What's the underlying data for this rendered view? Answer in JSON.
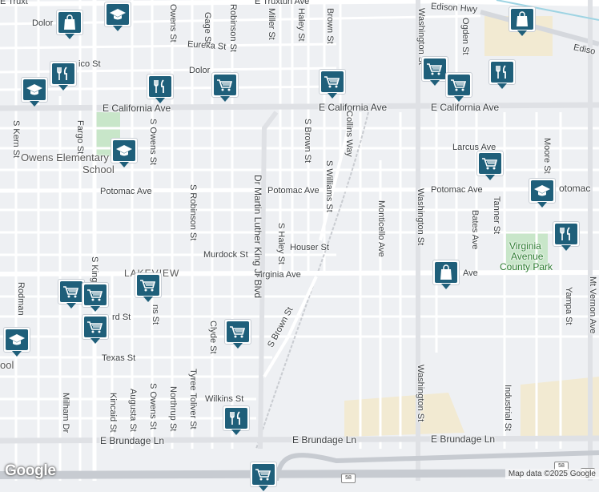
{
  "streets": {
    "e_truxtun": "E Truxtun Ave",
    "e_truxtun_left": "E Truxt",
    "edison_hwy": "Edison Hwy",
    "edison_hwy_right": "Ediso",
    "dolores": "Dolor",
    "dolores2": "Dolor",
    "eureka": "Eureka St",
    "mexico": "ico St",
    "e_california_1": "E California Ave",
    "e_california_2": "E California Ave",
    "larcus": "Larcus Ave",
    "potomac_1": "Potomac Ave",
    "potomac_2": "Potomac Ave",
    "potomac_3": "Potomac Ave",
    "potomac_4": "otomac",
    "murdock": "Murdock St",
    "houser": "Houser St",
    "virginia_1": "Virginia Ave",
    "virginia_2": "Ave",
    "ord": "rd St",
    "texas": "Texas St",
    "wilkins": "Wilkins St",
    "brundage_1": "E Brundage Ln",
    "brundage_2": "E Brundage Ln",
    "brundage_3": "E Brundage Ln",
    "s_kern": "S Kern St",
    "fargo": "Fargo St",
    "s_king": "S King",
    "rodman": "Rodman",
    "milham": "Milham Dr",
    "kincaid": "Kincaid St",
    "augusta": "Augusta St",
    "s_owens_top": "Owens St",
    "s_owens_mid": "S Owens St",
    "s_owens_bot": "S Owens St",
    "s_owens_low": "ns St",
    "northrup": "Northrup St",
    "tyree": "Tyree Toliver St",
    "robinson_top": "Robinson St",
    "s_robinson": "S Robinson St",
    "clyde": "Clyde St",
    "gage": "Gage St",
    "miller": "Miller St",
    "haley": "Haley St",
    "brown": "Brown St",
    "mlk": "Dr Martin Luther King Jr Blvd",
    "s_brown": "S Brown St",
    "s_brown_diag": "S Brown St",
    "s_haley": "S Haley St",
    "s_williams": "S Williams St",
    "collins": "Collins Way",
    "monticello": "Monticello Ave",
    "washington_1": "Washington St",
    "washington_2": "Washington St",
    "washington_3": "Washington St",
    "ogden": "Ogden St",
    "bates": "Bates Ave",
    "tanner": "Tanner St",
    "moore": "Moore St",
    "industrial": "Industrial St",
    "yampa": "Yampa St",
    "mt_vernon": "Mt Vernon Ave"
  },
  "places": {
    "owens_school_1": "Owens Elementary",
    "owens_school_2": "School",
    "lakeview": "LAKEVIEW",
    "park_1": "Virginia",
    "park_2": "Avenue",
    "park_3": "County Park",
    "school_left": "ool"
  },
  "highway": {
    "route": "58",
    "route2": "58",
    "route3": "58"
  },
  "pins": [
    {
      "type": "shopping-bag",
      "name": "pin-shopping-1"
    },
    {
      "type": "school",
      "name": "pin-school-1"
    },
    {
      "type": "shopping-bag",
      "name": "pin-shopping-2"
    },
    {
      "type": "restaurant",
      "name": "pin-restaurant-1"
    },
    {
      "type": "school",
      "name": "pin-school-2"
    },
    {
      "type": "restaurant",
      "name": "pin-restaurant-2"
    },
    {
      "type": "grocery",
      "name": "pin-grocery-1"
    },
    {
      "type": "grocery",
      "name": "pin-grocery-2"
    },
    {
      "type": "grocery",
      "name": "pin-grocery-3"
    },
    {
      "type": "grocery",
      "name": "pin-grocery-4"
    },
    {
      "type": "restaurant",
      "name": "pin-restaurant-3"
    },
    {
      "type": "school",
      "name": "pin-school-3"
    },
    {
      "type": "grocery",
      "name": "pin-grocery-5"
    },
    {
      "type": "school",
      "name": "pin-school-4"
    },
    {
      "type": "restaurant",
      "name": "pin-restaurant-4"
    },
    {
      "type": "shopping-bag",
      "name": "pin-shopping-3"
    },
    {
      "type": "grocery",
      "name": "pin-grocery-6"
    },
    {
      "type": "grocery",
      "name": "pin-grocery-7"
    },
    {
      "type": "grocery",
      "name": "pin-grocery-8"
    },
    {
      "type": "school",
      "name": "pin-school-5"
    },
    {
      "type": "grocery",
      "name": "pin-grocery-9"
    },
    {
      "type": "grocery",
      "name": "pin-grocery-10"
    },
    {
      "type": "restaurant",
      "name": "pin-restaurant-5"
    },
    {
      "type": "grocery",
      "name": "pin-grocery-11"
    }
  ],
  "branding": {
    "logo": "Google",
    "attribution": "Map data ©2025 Google"
  },
  "colors": {
    "pin": "#1f5f7a",
    "park": "#c8e6c9",
    "road": "#ffffff",
    "highway": "#c7cbd1",
    "sand": "#f2ead2"
  }
}
